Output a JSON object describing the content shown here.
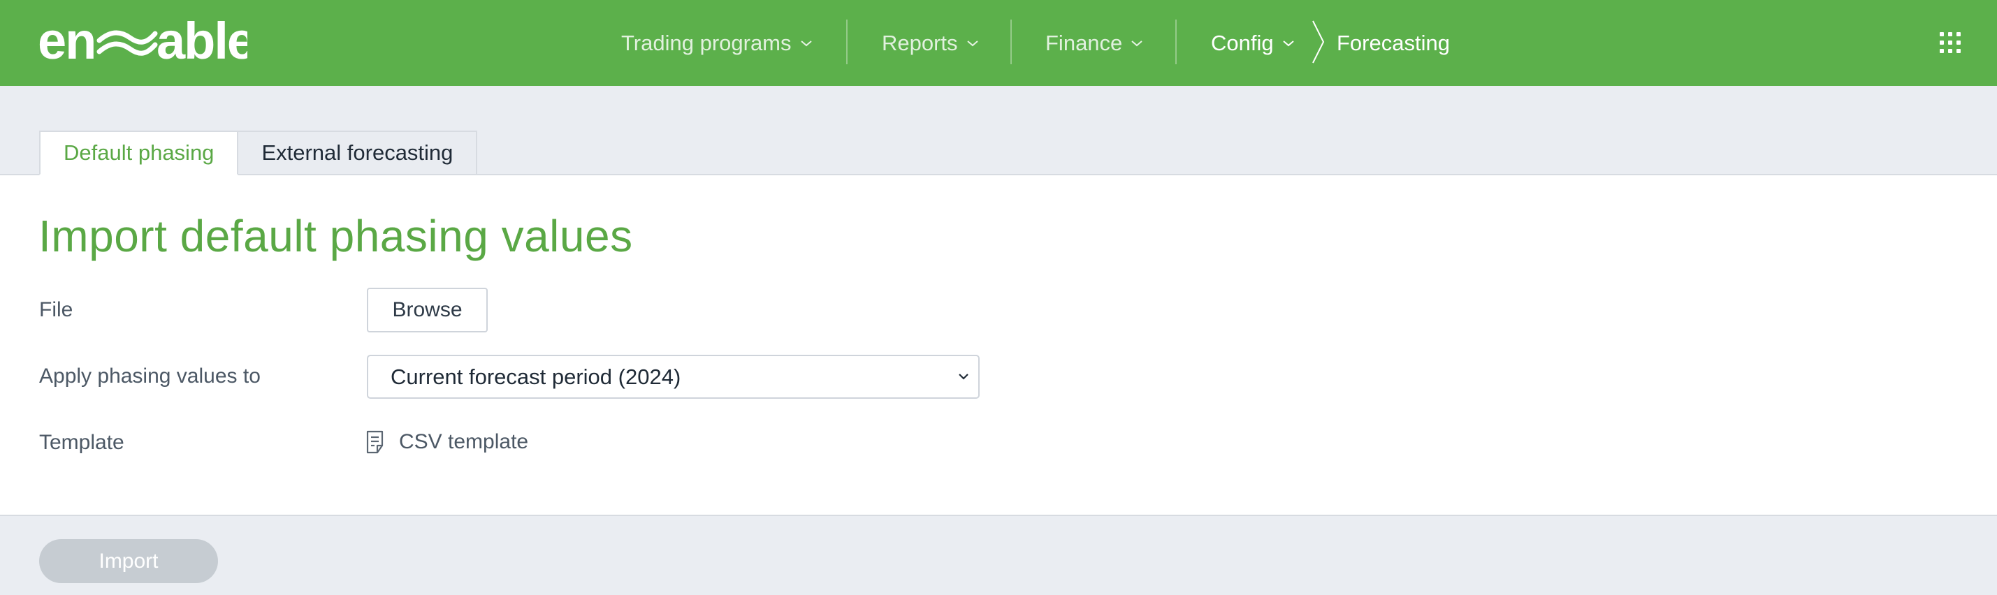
{
  "brand": {
    "logo_text": "enable",
    "accent": "#5cb04b",
    "title_color": "#5aa845"
  },
  "nav": {
    "items": [
      {
        "label": "Trading programs",
        "icon": "chevron-down-icon"
      },
      {
        "label": "Reports",
        "icon": "chevron-down-icon"
      },
      {
        "label": "Finance",
        "icon": "chevron-down-icon"
      },
      {
        "label": "Config",
        "icon": "chevron-down-icon"
      }
    ],
    "breadcrumb_current": "Forecasting",
    "apps_icon": "grid-icon"
  },
  "tabs": [
    {
      "label": "Default phasing",
      "active": true
    },
    {
      "label": "External forecasting",
      "active": false
    }
  ],
  "page": {
    "title": "Import default phasing values",
    "file_label": "File",
    "browse_label": "Browse",
    "apply_label": "Apply phasing values to",
    "apply_selected": "Current forecast period (2024)",
    "template_label": "Template",
    "template_link": "CSV template",
    "template_icon": "document-icon"
  },
  "footer": {
    "import_label": "Import",
    "import_disabled": true
  }
}
